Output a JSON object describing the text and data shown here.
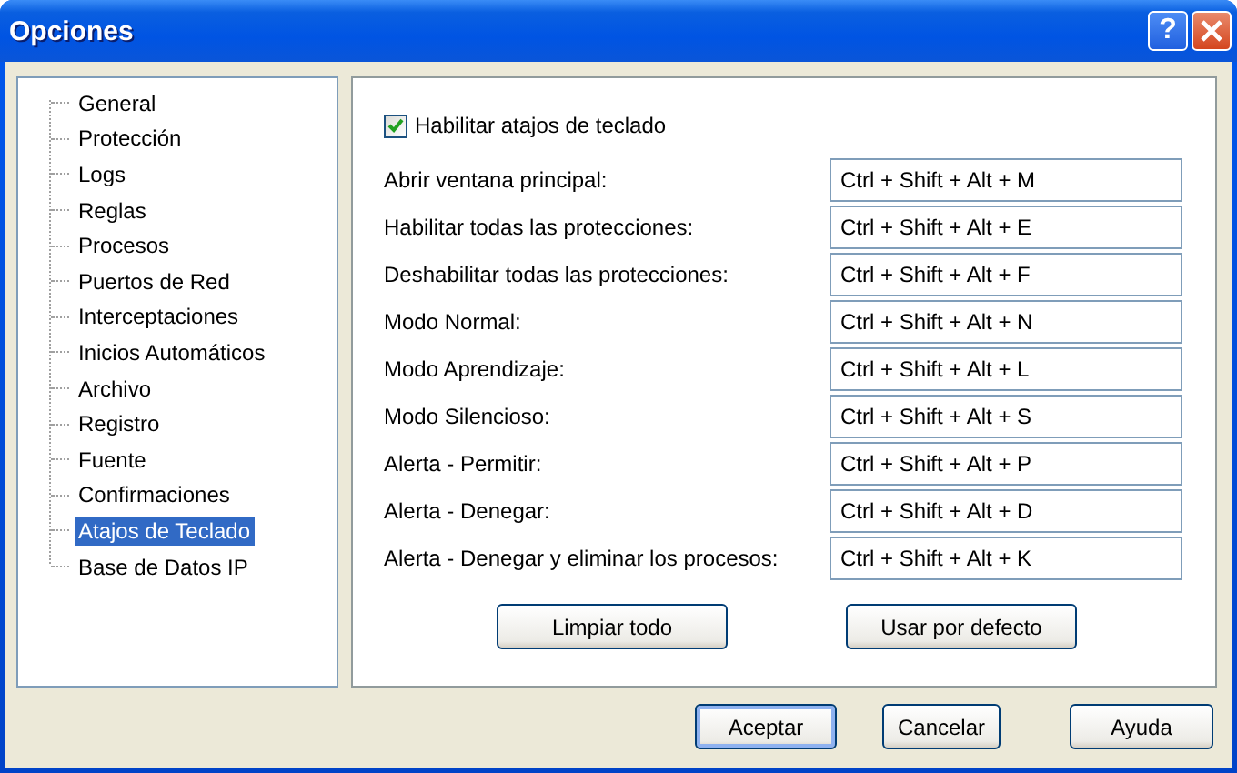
{
  "window": {
    "title": "Opciones",
    "help_button": "?"
  },
  "tree": [
    {
      "label": "General",
      "selected": false
    },
    {
      "label": "Protección",
      "selected": false
    },
    {
      "label": "Logs",
      "selected": false
    },
    {
      "label": "Reglas",
      "selected": false
    },
    {
      "label": "Procesos",
      "selected": false
    },
    {
      "label": "Puertos de Red",
      "selected": false
    },
    {
      "label": "Interceptaciones",
      "selected": false
    },
    {
      "label": "Inicios Automáticos",
      "selected": false
    },
    {
      "label": "Archivo",
      "selected": false
    },
    {
      "label": "Registro",
      "selected": false
    },
    {
      "label": "Fuente",
      "selected": false
    },
    {
      "label": "Confirmaciones",
      "selected": false
    },
    {
      "label": "Atajos de Teclado",
      "selected": true
    },
    {
      "label": "Base de Datos IP",
      "selected": false
    }
  ],
  "enable_shortcuts": {
    "label": "Habilitar atajos de teclado",
    "checked": true
  },
  "shortcuts": [
    {
      "label": "Abrir ventana principal:",
      "value": "Ctrl + Shift + Alt + M"
    },
    {
      "label": "Habilitar todas las protecciones:",
      "value": "Ctrl + Shift + Alt + E"
    },
    {
      "label": "Deshabilitar todas las protecciones:",
      "value": "Ctrl + Shift + Alt + F"
    },
    {
      "label": "Modo Normal:",
      "value": "Ctrl + Shift + Alt + N"
    },
    {
      "label": "Modo Aprendizaje:",
      "value": "Ctrl + Shift + Alt + L"
    },
    {
      "label": "Modo Silencioso:",
      "value": "Ctrl + Shift + Alt + S"
    },
    {
      "label": "Alerta - Permitir:",
      "value": "Ctrl + Shift + Alt + P"
    },
    {
      "label": "Alerta - Denegar:",
      "value": "Ctrl + Shift + Alt + D"
    },
    {
      "label": "Alerta - Denegar y eliminar los procesos:",
      "value": "Ctrl + Shift + Alt + K"
    }
  ],
  "panel_buttons": [
    "Limpiar todo",
    "Usar por defecto"
  ],
  "footer_buttons": [
    {
      "label": "Aceptar",
      "default": true
    },
    {
      "label": "Cancelar",
      "default": false
    },
    {
      "label": "Ayuda",
      "default": false
    }
  ]
}
